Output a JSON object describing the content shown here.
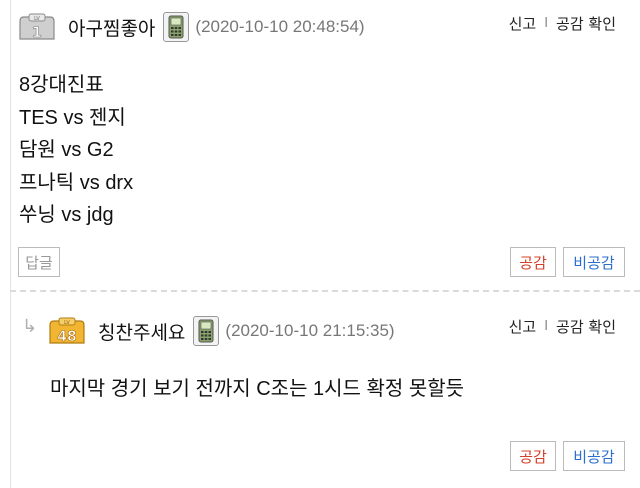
{
  "comments": [
    {
      "nickname": "아구찜좋아",
      "level_text": "1",
      "date": "(2020-10-10 20:48:54)",
      "report": "신고",
      "separator": "I",
      "check": "공감 확인",
      "lines": [
        "8강대진표",
        "TES vs 젠지",
        "담원 vs G2",
        "프나틱 vs drx",
        "쑤닝 vs jdg"
      ],
      "reply_label": "답글",
      "like_label": "공감",
      "dislike_label": "비공감"
    },
    {
      "nickname": "칭찬주세요",
      "level_text": "48",
      "date": "(2020-10-10 21:15:35)",
      "report": "신고",
      "separator": "I",
      "check": "공감 확인",
      "lines": [
        "마지막 경기 보기 전까지 C조는 1시드 확정 못할듯"
      ],
      "like_label": "공감",
      "dislike_label": "비공감",
      "reply_arrow": "↳"
    }
  ],
  "colors": {
    "like": "#d4402b",
    "dislike": "#2a6fcf",
    "badge_gold": "#f2b532",
    "badge_gray": "#c9c9c9"
  }
}
